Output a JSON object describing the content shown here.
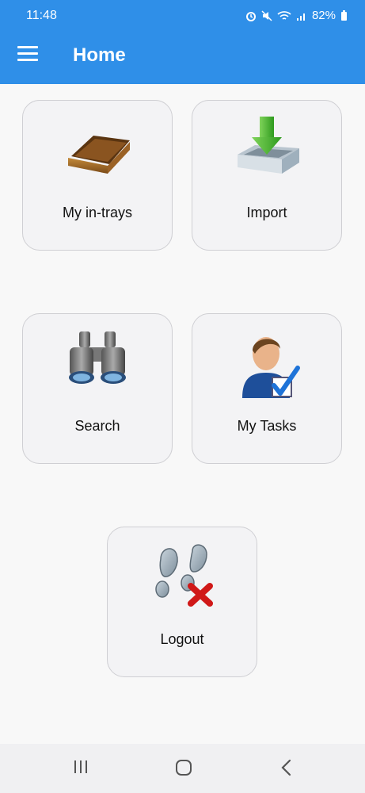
{
  "status_bar": {
    "time": "11:48",
    "battery": "82%"
  },
  "app_bar": {
    "title": "Home",
    "menu_icon": "hamburger-menu-icon"
  },
  "tiles": [
    {
      "label": "My in-trays",
      "icon": "in-tray-icon"
    },
    {
      "label": "Import",
      "icon": "import-icon"
    },
    {
      "label": "Search",
      "icon": "binoculars-icon"
    },
    {
      "label": "My Tasks",
      "icon": "user-check-icon"
    },
    {
      "label": "Logout",
      "icon": "footprints-logout-icon"
    }
  ],
  "nav_bar": [
    "recent-apps-icon",
    "home-icon",
    "back-icon"
  ],
  "colors": {
    "accent": "#2f8fe8",
    "tile_bg": "#f3f3f5",
    "tile_border": "#cfcfd3"
  }
}
